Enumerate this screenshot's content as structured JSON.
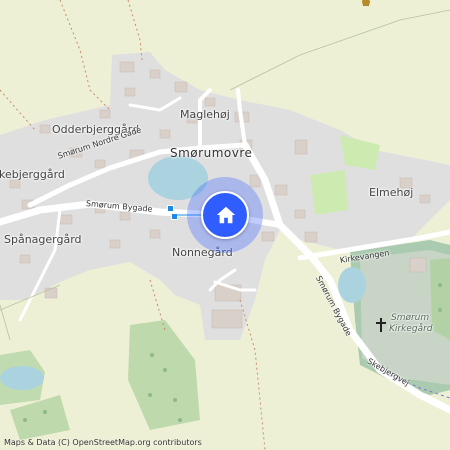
{
  "map": {
    "town_label": "Smørumovre",
    "places": {
      "odderbjerggard": "Odderbjerggård",
      "maglehoj": "Maglehøj",
      "skebjerggard": "Skebjerggård",
      "spanagergard": "Spånagergård",
      "nonnegard": "Nonnegård",
      "elmehoj": "Elmehøj"
    },
    "streets": {
      "smorum_nordre_gade": "Smørum Nordre Gade",
      "smorum_bygade_west": "Smørum Bygade",
      "smorum_bygade_south": "Smørum Bygade",
      "kirkevangen": "Kirkevangen",
      "skebjergvej": "Skebjergvej"
    },
    "poi": {
      "cemetery_line1": "Smørum",
      "cemetery_line2": "Kirkegård"
    },
    "attribution": "Maps & Data (C) OpenStreetMap.org contributors",
    "colors": {
      "background": "#f2efe9",
      "residential": "#e0dfdf",
      "farmland": "#eef0d5",
      "grass": "#cdebb0",
      "forest": "#add19e",
      "water": "#aad3df",
      "building": "#d9d0c9",
      "road": "#ffffff",
      "location": "#2f5dff"
    },
    "icons": {
      "current_location": "home-icon",
      "cemetery": "cross-icon",
      "tree": "tree-icon"
    }
  }
}
